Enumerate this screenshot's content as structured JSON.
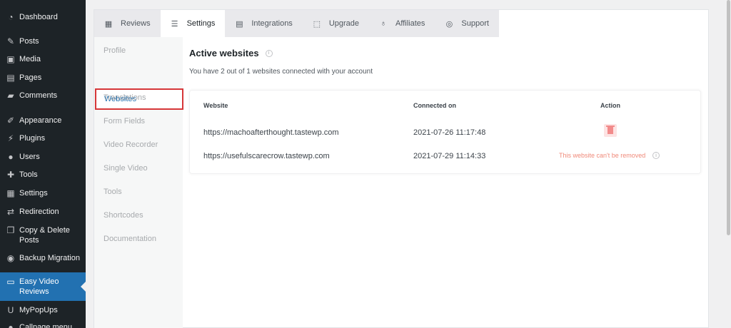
{
  "sidebar": {
    "items": [
      {
        "label": "Dashboard",
        "icon": "dashboard-icon",
        "glyph": "◔"
      },
      {
        "label": "Posts",
        "icon": "pin-icon",
        "glyph": "✎"
      },
      {
        "label": "Media",
        "icon": "media-icon",
        "glyph": "▣"
      },
      {
        "label": "Pages",
        "icon": "pages-icon",
        "glyph": "▤"
      },
      {
        "label": "Comments",
        "icon": "comments-icon",
        "glyph": "▰"
      },
      {
        "label": "Appearance",
        "icon": "brush-icon",
        "glyph": "✐"
      },
      {
        "label": "Plugins",
        "icon": "plug-icon",
        "glyph": "⚡"
      },
      {
        "label": "Users",
        "icon": "user-icon",
        "glyph": "●"
      },
      {
        "label": "Tools",
        "icon": "wrench-icon",
        "glyph": "✚"
      },
      {
        "label": "Settings",
        "icon": "settings-icon",
        "glyph": "▦"
      },
      {
        "label": "Redirection",
        "icon": "redirect-icon",
        "glyph": "⇄"
      },
      {
        "label": "Copy & Delete\nPosts",
        "icon": "copy-icon",
        "glyph": "❐"
      },
      {
        "label": "Backup Migration",
        "icon": "backup-icon",
        "glyph": "◉"
      },
      {
        "label": "Easy Video\nReviews",
        "icon": "video-icon",
        "glyph": "▭"
      },
      {
        "label": "MyPopUps",
        "icon": "popup-icon",
        "glyph": "U"
      },
      {
        "label": "Callpage menu",
        "icon": "phone-icon",
        "glyph": "●"
      }
    ]
  },
  "tabs": [
    {
      "label": "Reviews",
      "icon": "film-icon",
      "glyph": "▦"
    },
    {
      "label": "Settings",
      "icon": "sliders-icon",
      "glyph": "☰"
    },
    {
      "label": "Integrations",
      "icon": "document-icon",
      "glyph": "▤"
    },
    {
      "label": "Upgrade",
      "icon": "gift-icon",
      "glyph": "⬚"
    },
    {
      "label": "Affiliates",
      "icon": "medal-icon",
      "glyph": "♁"
    },
    {
      "label": "Support",
      "icon": "lifebuoy-icon",
      "glyph": "◎"
    }
  ],
  "subnav": {
    "items": [
      "Profile",
      "Websites",
      "Translations",
      "Form Fields",
      "Video Recorder",
      "Single Video",
      "Tools",
      "Shortcodes",
      "Documentation"
    ],
    "active": "Websites"
  },
  "content": {
    "title": "Active websites",
    "subtitle": "You have 2 out of 1 websites connected with your account"
  },
  "table": {
    "headers": {
      "website": "Website",
      "connected": "Connected on",
      "action": "Action"
    },
    "rows": [
      {
        "website": "https://machoafterthought.tastewp.com",
        "connected": "2021-07-26 11:17:48"
      },
      {
        "website": "https://usefulscarecrow.tastewp.com",
        "connected": "2021-07-29 11:14:33",
        "note": "This website can't be removed"
      }
    ]
  },
  "colors": {
    "sidebar_bg": "#1d2327",
    "active_blue": "#2271b1",
    "highlight_red": "#d63638",
    "danger_text": "#f08a7a"
  }
}
